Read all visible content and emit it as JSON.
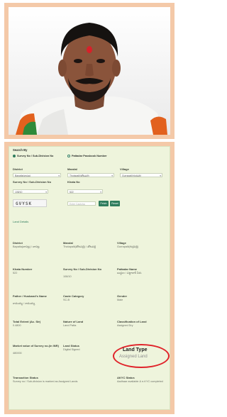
{
  "form": {
    "search_by": "Search By",
    "radio_survey": "Survey No / Sub-Division No",
    "radio_passbook": "Pattadar Passbook Number",
    "district_label": "District",
    "mandal_label": "Mandal",
    "village_label": "Village",
    "district_value": "Bapatla(బాపట్ల)",
    "mandal_value": "Thotapalli(తోటపల్లి)",
    "village_value": "Gurrapalli(గుర్రపల్లి)",
    "survey_label": "Survey No / Sub-Division No",
    "khata_label": "Khata No",
    "survey_value": "108/10",
    "khata_value": "522",
    "captcha_text": "GVYSK",
    "captcha_placeholder": "Enter Captcha",
    "fetch_button": "Fetch",
    "reset_button": "Reset"
  },
  "details": {
    "section_title": "Land Details",
    "fields": [
      {
        "label": "District",
        "value": "Bapatla(బాపట్ల) / బాపట్ల"
      },
      {
        "label": "Mandal",
        "value": "Thotapalli(తోటపల్లి) / తోటపల్లి"
      },
      {
        "label": "Village",
        "value": "Gurrapalli(గుర్రపల్లి)"
      },
      {
        "label": "Khata Number",
        "value": "522"
      },
      {
        "label": "Survey No / Sub-Division No",
        "value": "108/10"
      },
      {
        "label": "Pattadar Name",
        "value": "బుధ్ధుల / పట్టాదార్ పేరు"
      },
      {
        "label": "Father / Husband's Name",
        "value": "రామయ్య / రామయ్య"
      },
      {
        "label": "Caste Category",
        "value": "SC-B"
      },
      {
        "label": "Gender",
        "value": "Male"
      },
      {
        "label": "Total Extent (Ac. Str)",
        "value": "0.4800"
      },
      {
        "label": "Nature of Land",
        "value": "Land Patta"
      },
      {
        "label": "Classification of Land",
        "value": "Assigned Dry"
      },
      {
        "label": "Market value of Survey no.(in INR)",
        "value": "480000"
      },
      {
        "label": "Land Status",
        "value": "Digital Signed"
      },
      {
        "label": "Transaction Status",
        "value": "Survey no / Sub-division is marked as Assigned Lands"
      },
      {
        "label": "AKYC Status",
        "value": "Aadhaar available & e-KYC completed"
      }
    ],
    "land_type_label": "Land Type",
    "land_type_value": "Assigned Land"
  },
  "colors": {
    "frame": "#f4c9a8",
    "accent": "#2f7c5d",
    "highlight": "#e0232a",
    "panel": "#eef4dc"
  }
}
